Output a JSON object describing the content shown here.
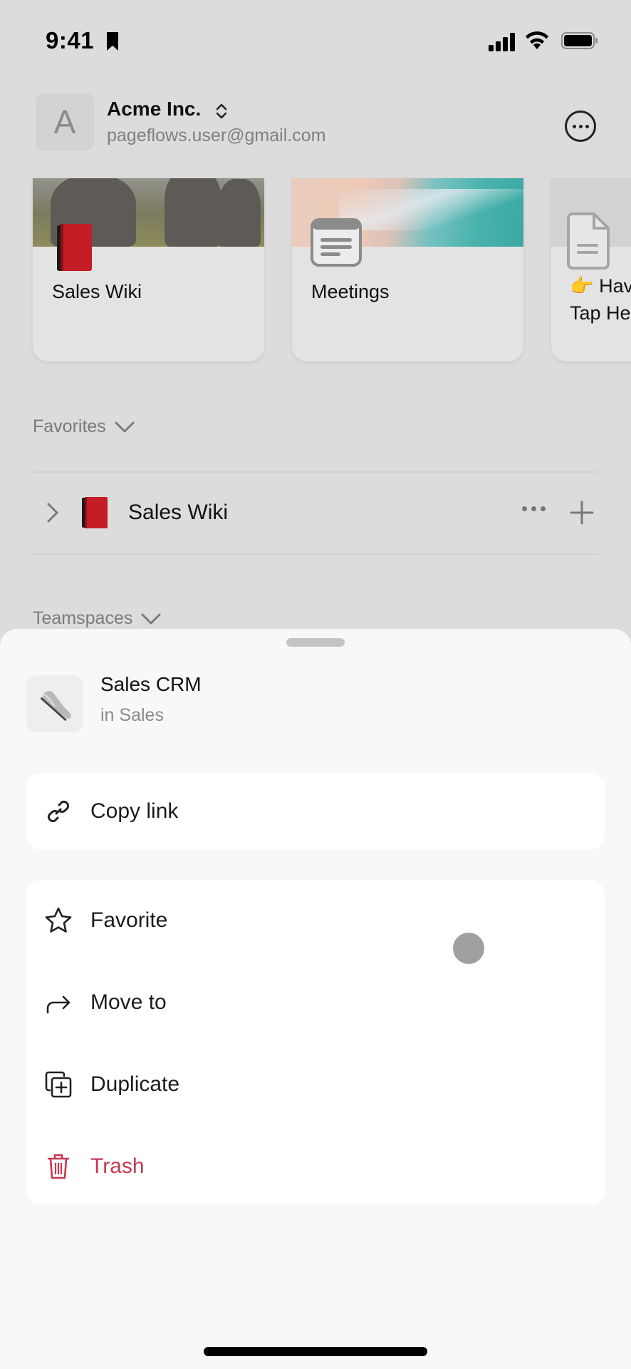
{
  "status_bar": {
    "time": "9:41",
    "icons": [
      "bookmark-icon",
      "cellular-signal-icon",
      "wifi-icon",
      "battery-icon"
    ]
  },
  "header": {
    "workspace_initial": "A",
    "workspace_name": "Acme Inc.",
    "email": "pageflows.user@gmail.com",
    "switch_icon": "chevron-up-down-icon",
    "more_icon": "more-circle-icon"
  },
  "cards": [
    {
      "title": "Sales Wiki",
      "cover": "elephants",
      "icon": "red-book-icon"
    },
    {
      "title": "Meetings",
      "cover": "beach",
      "icon": "database-icon"
    },
    {
      "title": "👉 Have Tap Here",
      "title_line1": "👉 Hav",
      "title_line2": "Tap He",
      "cover": "gray",
      "icon": "document-icon"
    }
  ],
  "favorites": {
    "label": "Favorites",
    "items": [
      {
        "title": "Sales Wiki",
        "icon": "red-book-icon"
      }
    ]
  },
  "teamspaces": {
    "label": "Teamspaces"
  },
  "sheet": {
    "page": {
      "title": "Sales CRM",
      "subtitle": "in Sales",
      "icon": "sneaker-icon"
    },
    "groups": [
      {
        "items": [
          {
            "label": "Copy link",
            "icon": "link-icon"
          }
        ]
      },
      {
        "items": [
          {
            "label": "Favorite",
            "icon": "star-icon"
          },
          {
            "label": "Move to",
            "icon": "move-arrow-icon"
          },
          {
            "label": "Duplicate",
            "icon": "duplicate-icon"
          },
          {
            "label": "Trash",
            "icon": "trash-icon",
            "danger": true
          }
        ]
      }
    ]
  },
  "colors": {
    "background": "#dddcdd",
    "sheet": "#f9f8f9",
    "danger": "#c6394f",
    "touch_indicator": "#a0a0a2"
  }
}
